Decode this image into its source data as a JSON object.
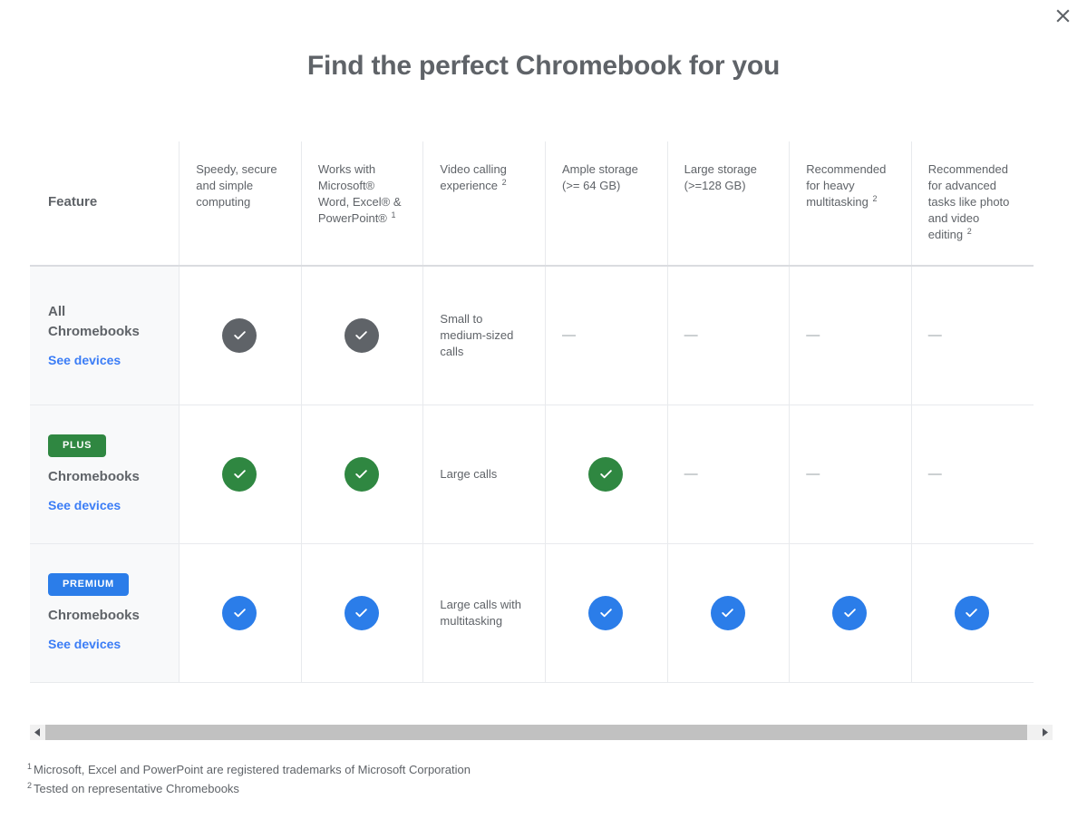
{
  "window": {
    "close_label": "×",
    "close_icon": "close-icon"
  },
  "header": {
    "title": "Find the perfect Chromebook for you"
  },
  "table": {
    "feature_column_label": "Feature",
    "columns": [
      {
        "label": "Speedy, secure and simple computing",
        "footnote": ""
      },
      {
        "label": "Works with Microsoft® Word, Excel® & PowerPoint®",
        "footnote": "1"
      },
      {
        "label": "Video calling experience",
        "footnote": "2"
      },
      {
        "label": "Ample storage (>= 64 GB)",
        "footnote": ""
      },
      {
        "label": "Large storage (>=128 GB)",
        "footnote": ""
      },
      {
        "label": "Recommended for heavy multitasking",
        "footnote": "2"
      },
      {
        "label": "Recommended for advanced tasks like photo and video editing",
        "footnote": "2"
      }
    ],
    "rows": [
      {
        "badge": "",
        "badge_color": "",
        "name_line1": "All",
        "name_line2": "Chromebooks",
        "link_label": "See devices",
        "check_color": "#5f6368",
        "check_class": "gray",
        "cells": [
          {
            "type": "check",
            "text": ""
          },
          {
            "type": "check",
            "text": ""
          },
          {
            "type": "text",
            "text": "Small to medium-sized calls"
          },
          {
            "type": "dash",
            "text": "—"
          },
          {
            "type": "dash",
            "text": "—"
          },
          {
            "type": "dash",
            "text": "—"
          },
          {
            "type": "dash",
            "text": "—"
          }
        ]
      },
      {
        "badge": "PLUS",
        "badge_color": "#2f8741",
        "name_line1": "",
        "name_line2": "Chromebooks",
        "link_label": "See devices",
        "check_color": "#2f8741",
        "check_class": "green",
        "cells": [
          {
            "type": "check",
            "text": ""
          },
          {
            "type": "check",
            "text": ""
          },
          {
            "type": "text",
            "text": "Large calls"
          },
          {
            "type": "check",
            "text": ""
          },
          {
            "type": "dash",
            "text": "—"
          },
          {
            "type": "dash",
            "text": "—"
          },
          {
            "type": "dash",
            "text": "—"
          }
        ]
      },
      {
        "badge": "PREMIUM",
        "badge_color": "#2b7de9",
        "name_line1": "",
        "name_line2": "Chromebooks",
        "link_label": "See devices",
        "check_color": "#2b7de9",
        "check_class": "blue",
        "cells": [
          {
            "type": "check",
            "text": ""
          },
          {
            "type": "check",
            "text": ""
          },
          {
            "type": "text",
            "text": "Large calls with multitasking"
          },
          {
            "type": "check",
            "text": ""
          },
          {
            "type": "check",
            "text": ""
          },
          {
            "type": "check",
            "text": ""
          },
          {
            "type": "check",
            "text": ""
          }
        ]
      }
    ]
  },
  "scrollbar": {
    "left_arrow_icon": "triangle-left-icon",
    "right_arrow_icon": "triangle-right-icon",
    "orientation": "horizontal"
  },
  "footnotes": [
    {
      "marker": "1",
      "text": "Microsoft, Excel and PowerPoint are registered trademarks of Microsoft Corporation"
    },
    {
      "marker": "2",
      "text": "Tested on representative Chromebooks"
    }
  ],
  "colors": {
    "link": "#3b7df6",
    "plus": "#2f8741",
    "premium": "#2b7de9",
    "all": "#5f6368",
    "text": "#5f6368",
    "border": "#e8eaed",
    "row_label_bg": "#f8f9fa"
  }
}
